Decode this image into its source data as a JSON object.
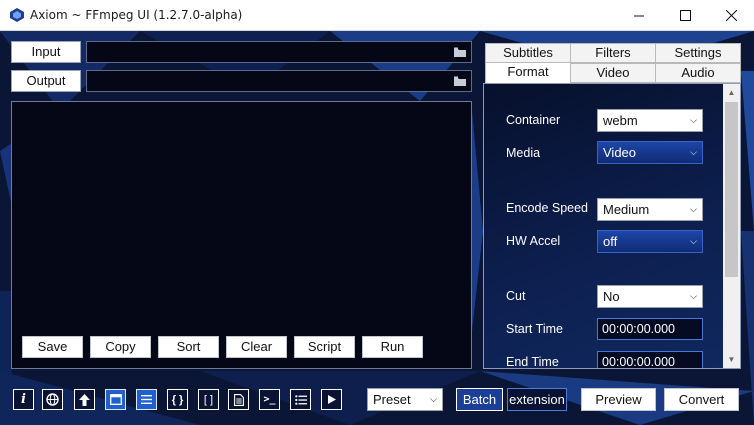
{
  "window": {
    "title": "Axiom ~ FFmpeg UI (1.2.7.0-alpha)"
  },
  "io": {
    "input_label": "Input",
    "output_label": "Output",
    "input_value": "",
    "output_value": ""
  },
  "console_buttons": [
    "Save",
    "Copy",
    "Sort",
    "Clear",
    "Script",
    "Run"
  ],
  "tabs": {
    "row1": [
      "Subtitles",
      "Filters",
      "Settings"
    ],
    "row2": [
      "Format",
      "Video",
      "Audio"
    ],
    "active": "Format"
  },
  "format": {
    "container_label": "Container",
    "container_value": "webm",
    "media_label": "Media",
    "media_value": "Video",
    "encode_speed_label": "Encode Speed",
    "encode_speed_value": "Medium",
    "hw_accel_label": "HW Accel",
    "hw_accel_value": "off",
    "cut_label": "Cut",
    "cut_value": "No",
    "start_time_label": "Start Time",
    "start_time_value": "00:00:00.000",
    "end_time_label": "End Time",
    "end_time_value": "00:00:00.000"
  },
  "toolbar": {
    "icons": [
      "info-icon",
      "globe-icon",
      "upload-icon",
      "window-icon",
      "menu-icon",
      "braces-icon",
      "brackets-icon",
      "document-icon",
      "terminal-icon",
      "list-icon",
      "play-icon"
    ],
    "info_glyph": "i",
    "braces_glyph": "{ }",
    "brackets_glyph": "[ ]",
    "terminal_glyph": ">_",
    "preset_value": "Preset",
    "batch_label": "Batch",
    "extension_label": "extension",
    "preview_label": "Preview",
    "convert_label": "Convert"
  },
  "colors": {
    "accent": "#1f5fce",
    "background": "#0b1636",
    "console_bg": "#050716"
  }
}
